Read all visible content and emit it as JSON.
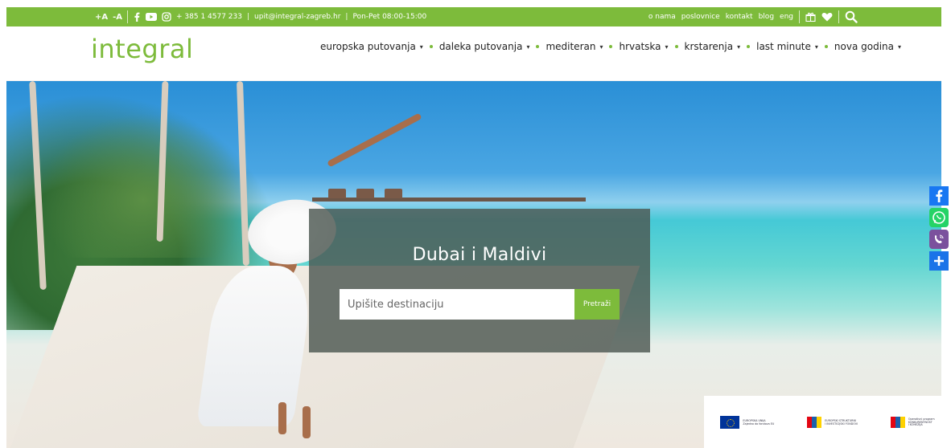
{
  "topbar": {
    "font_increase": "+A",
    "font_decrease": "-A",
    "phone": "+ 385 1 4577 233",
    "divider": "|",
    "email": "upit@integral-zagreb.hr",
    "hours": "Pon-Pet 08:00-15:00",
    "links": [
      "o nama",
      "poslovnice",
      "kontakt",
      "blog",
      "eng"
    ],
    "accent_color": "#7dbb3b"
  },
  "header": {
    "logo": "integral",
    "nav": [
      {
        "label": "europska putovanja"
      },
      {
        "label": "daleka putovanja"
      },
      {
        "label": "mediteran"
      },
      {
        "label": "hrvatska"
      },
      {
        "label": "krstarenja"
      },
      {
        "label": "last minute"
      },
      {
        "label": "nova godina"
      }
    ]
  },
  "hero": {
    "title": "Dubai i Maldivi",
    "search_placeholder": "Upišite destinaciju",
    "search_button": "Pretraži"
  },
  "social": [
    "facebook-icon",
    "whatsapp-icon",
    "viber-icon",
    "add-icon"
  ],
  "eu_funds": {
    "eu_line1": "EUROPSKA UNIJA",
    "eu_line2": "Zajedno do fondova EU",
    "esif_line1": "EUROPSKI STRUKTURNI",
    "esif_line2": "I INVESTICIJSKI FONDOVI",
    "op_line1": "Operativni program",
    "op_line2": "KONKURENTNOST",
    "op_line3": "I KOHEZIJA"
  }
}
